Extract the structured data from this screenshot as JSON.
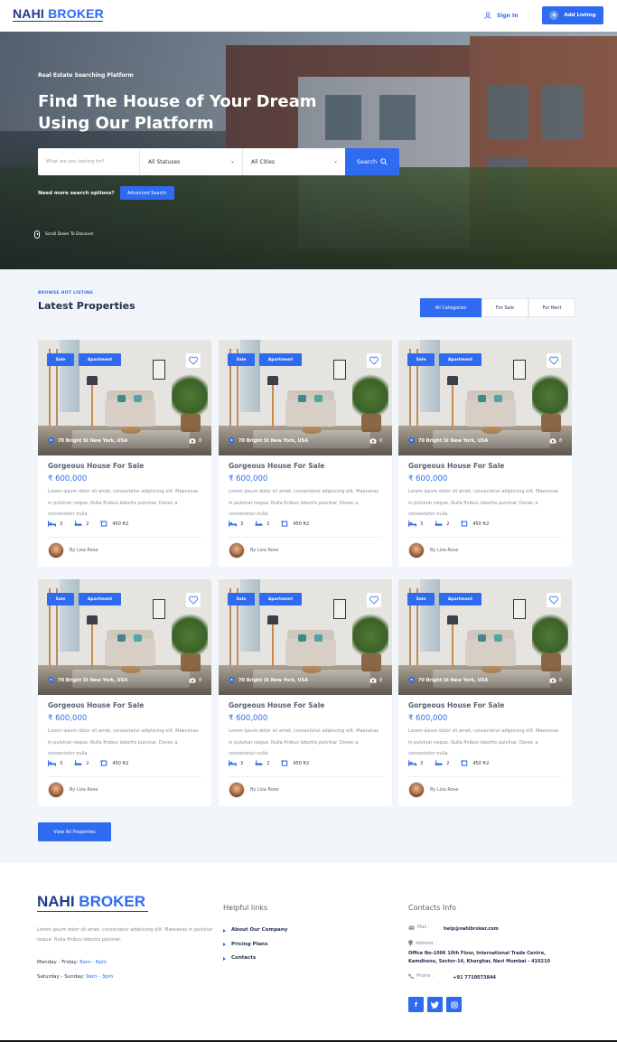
{
  "header": {
    "logo_part1": "NAHI",
    "logo_part2": "BROKER",
    "signin": "Sign In",
    "add_listing": "Add Listing"
  },
  "hero": {
    "eyebrow": "Real Estate Searching Platform",
    "title": "Find The House of Your Dream Using Our Platform",
    "search_placeholder": "What are you looking for?",
    "status_select": "All Statuses",
    "city_select": "All Cities",
    "search_button": "Search",
    "advanced_question": "Need more search options?",
    "advanced_button": "Advanced Search",
    "scroll_hint": "Scroll Down To Discover"
  },
  "listing": {
    "eyebrow": "BROWSE HOT LISTING",
    "title": "Latest Properties",
    "tabs": [
      "All Categories",
      "For Sale",
      "For Rent"
    ],
    "view_all": "View All Properties",
    "cards": [
      {
        "status": "Sale",
        "type": "Apartment",
        "address": "70 Bright St New York, USA",
        "photos": "8",
        "title": "Gorgeous House For Sale",
        "price": "₹ 600,000",
        "description": "Lorem ipsum dolor sit amet, consectetur adipiscing elit. Maecenas in pulvinar neque. Nulla finibus lobortis pulvinar. Donec a consectetur nulla.",
        "beds": "3",
        "baths": "2",
        "area": "450 ft2",
        "agent": "By Liza Rose"
      },
      {
        "status": "Sale",
        "type": "Apartment",
        "address": "70 Bright St New York, USA",
        "photos": "8",
        "title": "Gorgeous House For Sale",
        "price": "₹ 600,000",
        "description": "Lorem ipsum dolor sit amet, consectetur adipiscing elit. Maecenas in pulvinar neque. Nulla finibus lobortis pulvinar. Donec a consectetur nulla.",
        "beds": "3",
        "baths": "2",
        "area": "450 ft2",
        "agent": "By Liza Rose"
      },
      {
        "status": "Sale",
        "type": "Apartment",
        "address": "70 Bright St New York, USA",
        "photos": "8",
        "title": "Gorgeous House For Sale",
        "price": "₹ 600,000",
        "description": "Lorem ipsum dolor sit amet, consectetur adipiscing elit. Maecenas in pulvinar neque. Nulla finibus lobortis pulvinar. Donec a consectetur nulla.",
        "beds": "3",
        "baths": "2",
        "area": "450 ft2",
        "agent": "By Liza Rose"
      },
      {
        "status": "Sale",
        "type": "Apartment",
        "address": "70 Bright St New York, USA",
        "photos": "8",
        "title": "Gorgeous House For Sale",
        "price": "₹ 600,000",
        "description": "Lorem ipsum dolor sit amet, consectetur adipiscing elit. Maecenas in pulvinar neque. Nulla finibus lobortis pulvinar. Donec a consectetur nulla.",
        "beds": "3",
        "baths": "2",
        "area": "450 ft2",
        "agent": "By Liza Rose"
      },
      {
        "status": "Sale",
        "type": "Apartment",
        "address": "70 Bright St New York, USA",
        "photos": "8",
        "title": "Gorgeous House For Sale",
        "price": "₹ 600,000",
        "description": "Lorem ipsum dolor sit amet, consectetur adipiscing elit. Maecenas in pulvinar neque. Nulla finibus lobortis pulvinar. Donec a consectetur nulla.",
        "beds": "3",
        "baths": "2",
        "area": "450 ft2",
        "agent": "By Liza Rose"
      },
      {
        "status": "Sale",
        "type": "Apartment",
        "address": "70 Bright St New York, USA",
        "photos": "8",
        "title": "Gorgeous House For Sale",
        "price": "₹ 600,000",
        "description": "Lorem ipsum dolor sit amet, consectetur adipiscing elit. Maecenas in pulvinar neque. Nulla finibus lobortis pulvinar. Donec a consectetur nulla.",
        "beds": "3",
        "baths": "2",
        "area": "450 ft2",
        "agent": "By Liza Rose"
      }
    ]
  },
  "footer": {
    "logo_part1": "NAHI",
    "logo_part2": "BROKER",
    "about": "Lorem ipsum dolor sit amet, consectetur adipiscing elit. Maecenas in pulvinar neque. Nulla finibus lobortis pulvinar.",
    "weekday_label": "Monday - Friday:",
    "weekday_hours": "8am - 6pm",
    "weekend_label": "Saturday - Sunday:",
    "weekend_hours": "9am - 3pm",
    "links_title": "Helpful links",
    "links": [
      "About Our Company",
      "Pricing Plans",
      "Contacts"
    ],
    "contacts_title": "Contacts Info",
    "mail_label": "Mail :",
    "mail": "help@nahibroker.com",
    "address_label": "Address :",
    "address": "Office No-1006 10th Floor, International Trade Centre, Kamdhenu, Sector-14, Kharghar, Navi Mumbai - 410210",
    "phone_label": "Phone :",
    "phone": "+91 7710073844",
    "socials": [
      "facebook-icon",
      "twitter-icon",
      "instagram-icon"
    ]
  },
  "colors": {
    "accent": "#2f6bf0",
    "navy": "#1e3a8a",
    "section_bg": "#f2f5fa"
  }
}
